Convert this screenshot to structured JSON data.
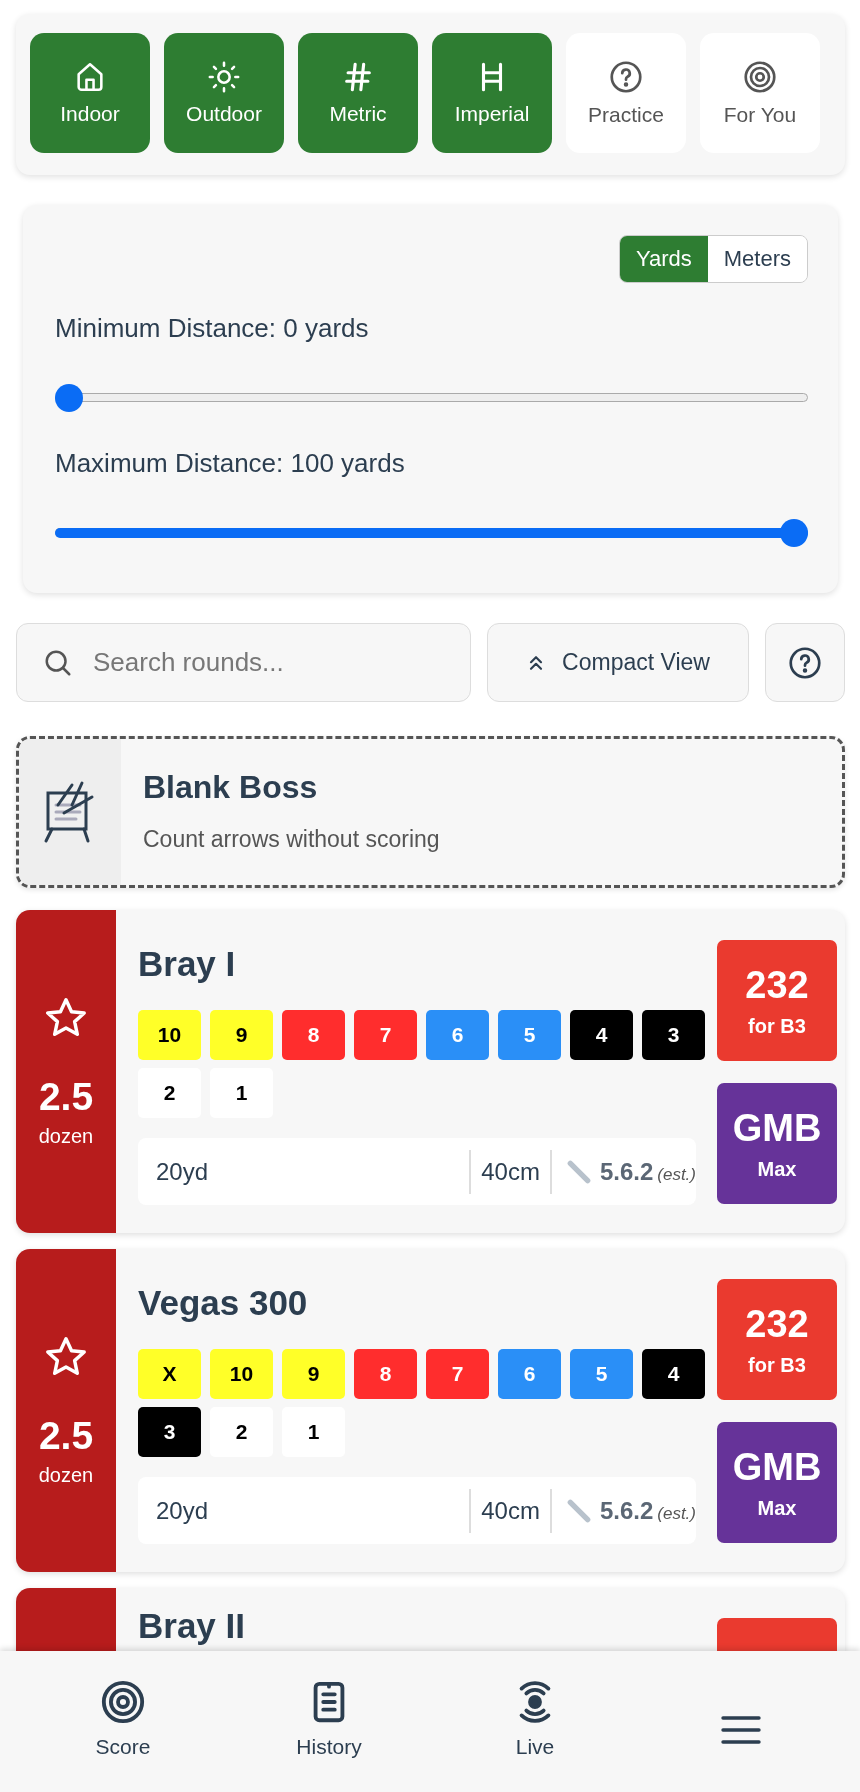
{
  "filters": [
    {
      "label": "Indoor",
      "selected": true
    },
    {
      "label": "Outdoor",
      "selected": true
    },
    {
      "label": "Metric",
      "selected": true
    },
    {
      "label": "Imperial",
      "selected": true
    },
    {
      "label": "Practice",
      "selected": false
    },
    {
      "label": "For You",
      "selected": false
    }
  ],
  "distance_settings": {
    "units": [
      {
        "label": "Yards",
        "selected": true
      },
      {
        "label": "Meters",
        "selected": false
      }
    ],
    "sliders": [
      {
        "label": "Minimum Distance: 0 yards",
        "level": 0
      },
      {
        "label": "Maximum Distance: 100 yards",
        "level": 1
      }
    ]
  },
  "search": {
    "placeholder": "Search rounds..."
  },
  "compact_view": {
    "label": "Compact View"
  },
  "blank_round": {
    "title": "Blank Boss",
    "subtitle": "Count arrows without scoring"
  },
  "rounds": [
    {
      "title": "Bray I",
      "dozen_value": "2.5",
      "dozen_label": "dozen",
      "scores": [
        {
          "label": "10",
          "color": "#ffff28"
        },
        {
          "label": "9",
          "color": "#ffff28"
        },
        {
          "label": "8",
          "color": "#ff2d2d"
        },
        {
          "label": "7",
          "color": "#ff2d2d"
        },
        {
          "label": "6",
          "color": "#2a8ff7"
        },
        {
          "label": "5",
          "color": "#2a8ff7"
        },
        {
          "label": "4",
          "color": "#000000"
        },
        {
          "label": "3",
          "color": "#000000"
        },
        {
          "label": "2",
          "color": "#ffffff"
        },
        {
          "label": "1",
          "color": "#ffffff"
        }
      ],
      "distance": "20yd",
      "face": "40cm",
      "arrow_size": "5.6.2",
      "arrow_note": "(est.)",
      "target": {
        "value": "232",
        "label": "for B3"
      },
      "classification": {
        "value": "GMB",
        "label": "Max"
      }
    },
    {
      "title": "Vegas 300",
      "dozen_value": "2.5",
      "dozen_label": "dozen",
      "scores": [
        {
          "label": "X",
          "color": "#ffff28"
        },
        {
          "label": "10",
          "color": "#ffff28"
        },
        {
          "label": "9",
          "color": "#ffff28"
        },
        {
          "label": "8",
          "color": "#ff2d2d"
        },
        {
          "label": "7",
          "color": "#ff2d2d"
        },
        {
          "label": "6",
          "color": "#2a8ff7"
        },
        {
          "label": "5",
          "color": "#2a8ff7"
        },
        {
          "label": "4",
          "color": "#000000"
        },
        {
          "label": "3",
          "color": "#000000"
        },
        {
          "label": "2",
          "color": "#ffffff"
        },
        {
          "label": "1",
          "color": "#ffffff"
        }
      ],
      "distance": "20yd",
      "face": "40cm",
      "arrow_size": "5.6.2",
      "arrow_note": "(est.)",
      "target": {
        "value": "232",
        "label": "for B3"
      },
      "classification": {
        "value": "GMB",
        "label": "Max"
      }
    },
    {
      "title": "Bray II"
    }
  ],
  "bottom_nav": [
    {
      "label": "Score"
    },
    {
      "label": "History"
    },
    {
      "label": "Live"
    },
    {
      "kind": "menu"
    }
  ]
}
